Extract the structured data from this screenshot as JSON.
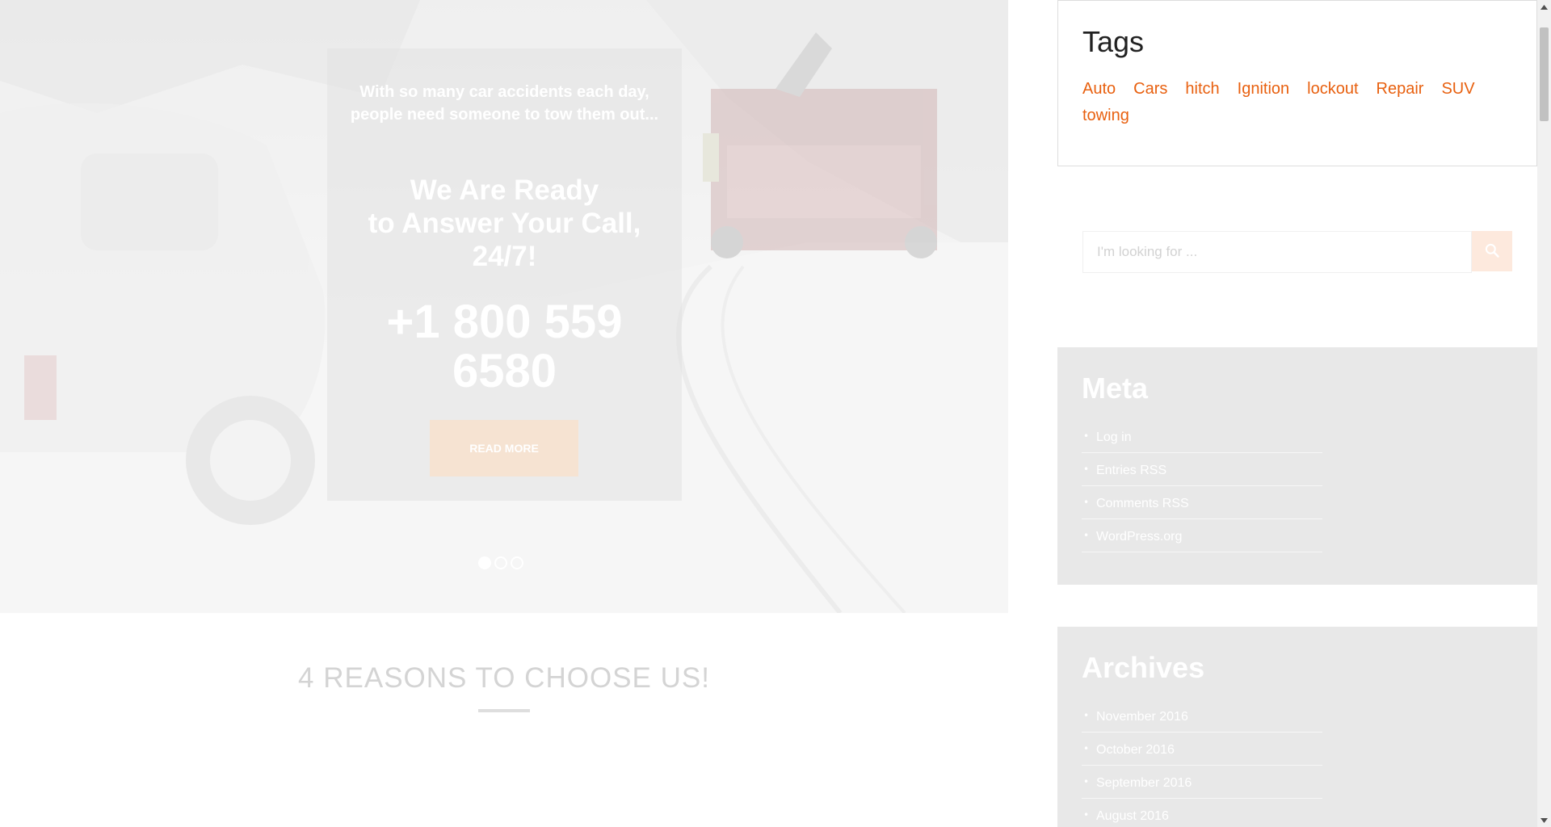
{
  "hero": {
    "intro": "With so many car accidents each day, people need someone to tow them out...",
    "heading": "We Are Ready\nto Answer Your Call, 24/7!",
    "phone": "+1 800 559 6580",
    "button_label": "READ MORE",
    "slide_count": 3,
    "active_slide": 1
  },
  "reasons": {
    "title": "4 REASONS TO CHOOSE US!"
  },
  "sidebar": {
    "tags": {
      "title": "Tags",
      "items": [
        "Auto",
        "Cars",
        "hitch",
        "Ignition",
        "lockout",
        "Repair",
        "SUV",
        "towing"
      ]
    },
    "search": {
      "placeholder": "I'm looking for ...",
      "icon": "search-icon"
    },
    "meta": {
      "title": "Meta",
      "items": [
        "Log in",
        "Entries RSS",
        "Comments RSS",
        "WordPress.org"
      ]
    },
    "archives": {
      "title": "Archives",
      "items": [
        "November 2016",
        "October 2016",
        "September 2016",
        "August 2016"
      ]
    }
  },
  "colors": {
    "accent": "#e8600f",
    "widget_gray": "#e8e8e8",
    "title_dark": "#222222"
  }
}
